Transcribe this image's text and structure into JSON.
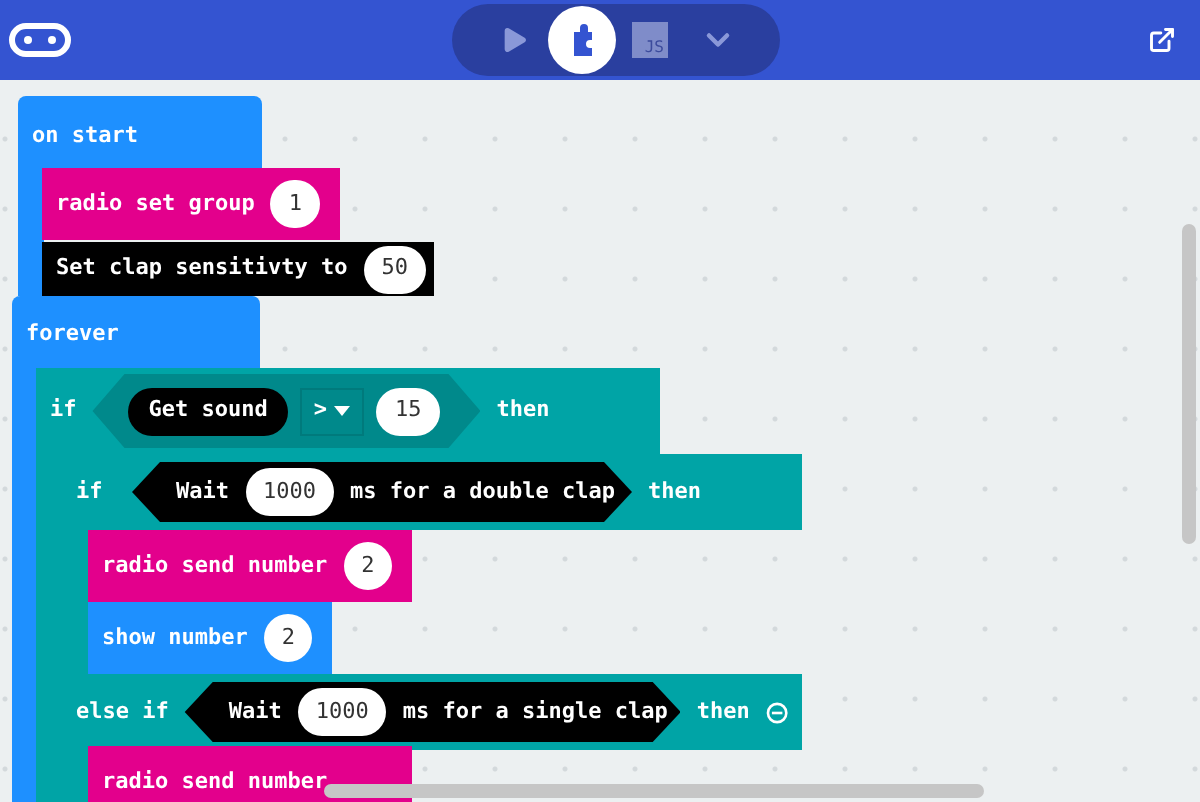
{
  "toolbar": {
    "modes": [
      {
        "kind": "play",
        "selected": false
      },
      {
        "kind": "blocks",
        "selected": true
      },
      {
        "kind": "js",
        "label": "JS",
        "selected": false
      },
      {
        "kind": "more",
        "selected": false
      }
    ]
  },
  "on_start": {
    "label": "on start",
    "blocks": [
      {
        "label": "radio set group",
        "value": "1",
        "color": "#e3008c"
      },
      {
        "label": "Set clap sensitivty to",
        "value": "50",
        "color": "#000000"
      }
    ]
  },
  "forever": {
    "label": "forever",
    "if_block": {
      "keyword": "if",
      "condition": {
        "reporter": "Get sound",
        "operator": ">",
        "value": "15"
      },
      "then": "then",
      "inner_if": {
        "keyword": "if",
        "condition": {
          "prefix": "Wait",
          "value": "1000",
          "suffix": "ms for a double clap"
        },
        "then": "then",
        "blocks": [
          {
            "label": "radio send number",
            "value": "2",
            "color": "#e3008c"
          },
          {
            "label": "show number",
            "value": "2",
            "color": "#1e90ff"
          }
        ],
        "else_if": {
          "keyword": "else if",
          "condition": {
            "prefix": "Wait",
            "value": "1000",
            "suffix": "ms for a single clap"
          },
          "then": "then",
          "blocks": [
            {
              "label": "radio send number",
              "color": "#e3008c"
            }
          ]
        }
      }
    }
  }
}
